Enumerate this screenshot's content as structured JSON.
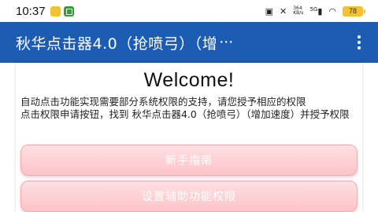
{
  "status_bar": {
    "time": "10:37",
    "signal_label": "5G",
    "network_small_top": "364",
    "network_small_bottom": "KB/s",
    "battery_level": "78"
  },
  "app_bar": {
    "title": "秋华点击器4.0（抢喷弓）（增",
    "title_ellipsis": "···",
    "overflow_icon": "more-vert-icon"
  },
  "main": {
    "welcome": "Welcome!",
    "desc_line1": "自动点击功能实现需要部分系统权限的支持，请您授予相应的权限",
    "desc_line2": "点击权限申请按钮，找到 秋华点击器4.0（抢喷弓）（增加速度）并授予权限",
    "guide_button": "新手指南",
    "accessibility_button": "设置辅助功能权限"
  },
  "colors": {
    "app_bar": "#1d5cb3",
    "button_pink": "#fcc3c8",
    "battery": "#f1c232"
  }
}
